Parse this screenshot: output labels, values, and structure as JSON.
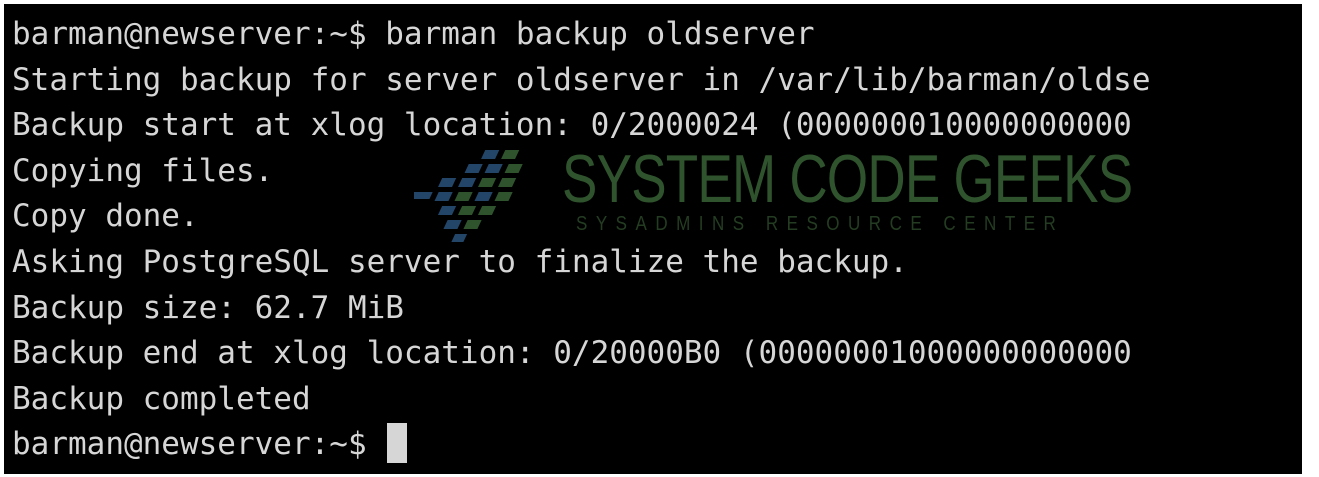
{
  "terminal": {
    "lines": [
      "barman@newserver:~$ barman backup oldserver",
      "Starting backup for server oldserver in /var/lib/barman/oldse",
      "Backup start at xlog location: 0/2000024 (000000010000000000",
      "Copying files.",
      "Copy done.",
      "Asking PostgreSQL server to finalize the backup.",
      "Backup size: 62.7 MiB",
      "Backup end at xlog location: 0/20000B0 (00000001000000000000",
      "Backup completed"
    ],
    "prompt": "barman@newserver:~$ "
  },
  "watermark": {
    "title": "SYSTEM CODE GEEKS",
    "subtitle": "SYSADMINS RESOURCE CENTER"
  },
  "colors": {
    "terminal_bg": "#000000",
    "terminal_fg": "#d6d6d6",
    "watermark_green": "#3d6b3a",
    "watermark_blue": "#2e5a86"
  }
}
